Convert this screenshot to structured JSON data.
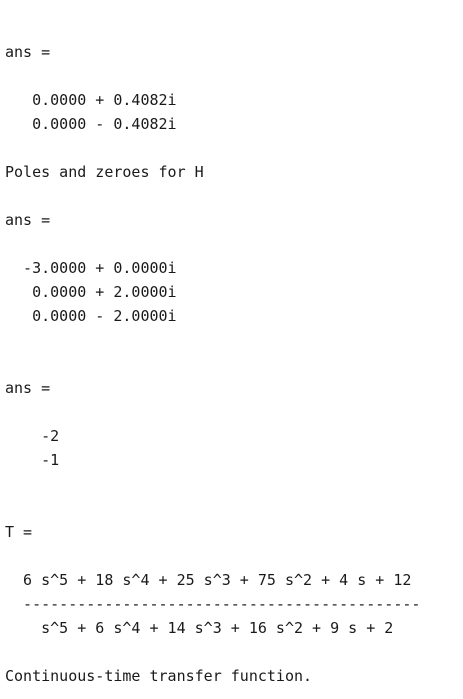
{
  "console": {
    "block1": {
      "label": "ans =",
      "rows": [
        "   0.0000 + 0.4082i",
        "   0.0000 - 0.4082i"
      ]
    },
    "heading": "Poles and zeroes for H",
    "block2": {
      "label": "ans =",
      "rows": [
        "  -3.0000 + 0.0000i",
        "   0.0000 + 2.0000i",
        "   0.0000 - 2.0000i"
      ]
    },
    "block3": {
      "label": "ans =",
      "rows": [
        "    -2",
        "    -1"
      ]
    },
    "transfer": {
      "label": "T =",
      "numerator": "  6 s^5 + 18 s^4 + 25 s^3 + 75 s^2 + 4 s + 12",
      "divider": "  --------------------------------------------",
      "denominator": "    s^5 + 6 s^4 + 14 s^3 + 16 s^2 + 9 s + 2",
      "footer": "Continuous-time transfer function."
    }
  }
}
